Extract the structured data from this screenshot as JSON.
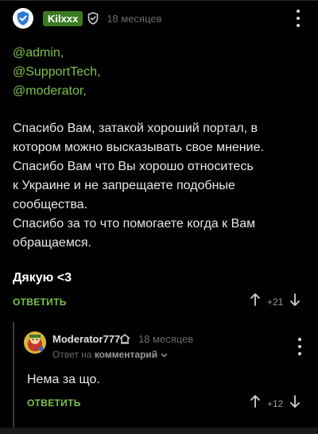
{
  "comment": {
    "username": "Kilxxx",
    "time": "18 месяцев",
    "mentions": [
      "@admin,",
      "@SupportTech,",
      "@moderator,"
    ],
    "paragraph_lines": [
      "Спасибо Вам, затакой хороший портал, в",
      "котором можно высказывать свое мнение.",
      "Спасибо Вам что Вы хорошо относитесь",
      "к Украине и не запрещаете подобные",
      "сообщества.",
      "Спасибо за то что помогаете когда к Вам",
      "обращаемся."
    ],
    "thanks": "Дякую <3",
    "reply_label": "ОТВЕТИТЬ",
    "rating": "+21"
  },
  "reply": {
    "username": "Moderator777",
    "time": "18 месяцев",
    "sub_prefix": "Ответ на",
    "sub_link": "комментарий",
    "text": "Нема за що.",
    "reply_label": "ОТВЕТИТЬ",
    "rating": "+12"
  },
  "colors": {
    "background": "#000000",
    "accent": "#7cc24a",
    "badge": "#3b7a22",
    "muted": "#6b6b6b"
  },
  "icons": {
    "avatar_main": "verified-shield-avatar",
    "moderator_badge": "shield-icon",
    "reply_avatar": "cartoon-avatar",
    "home": "home-icon",
    "upvote": "arrow-up-icon",
    "downvote": "arrow-down-icon",
    "more": "kebab-icon"
  }
}
